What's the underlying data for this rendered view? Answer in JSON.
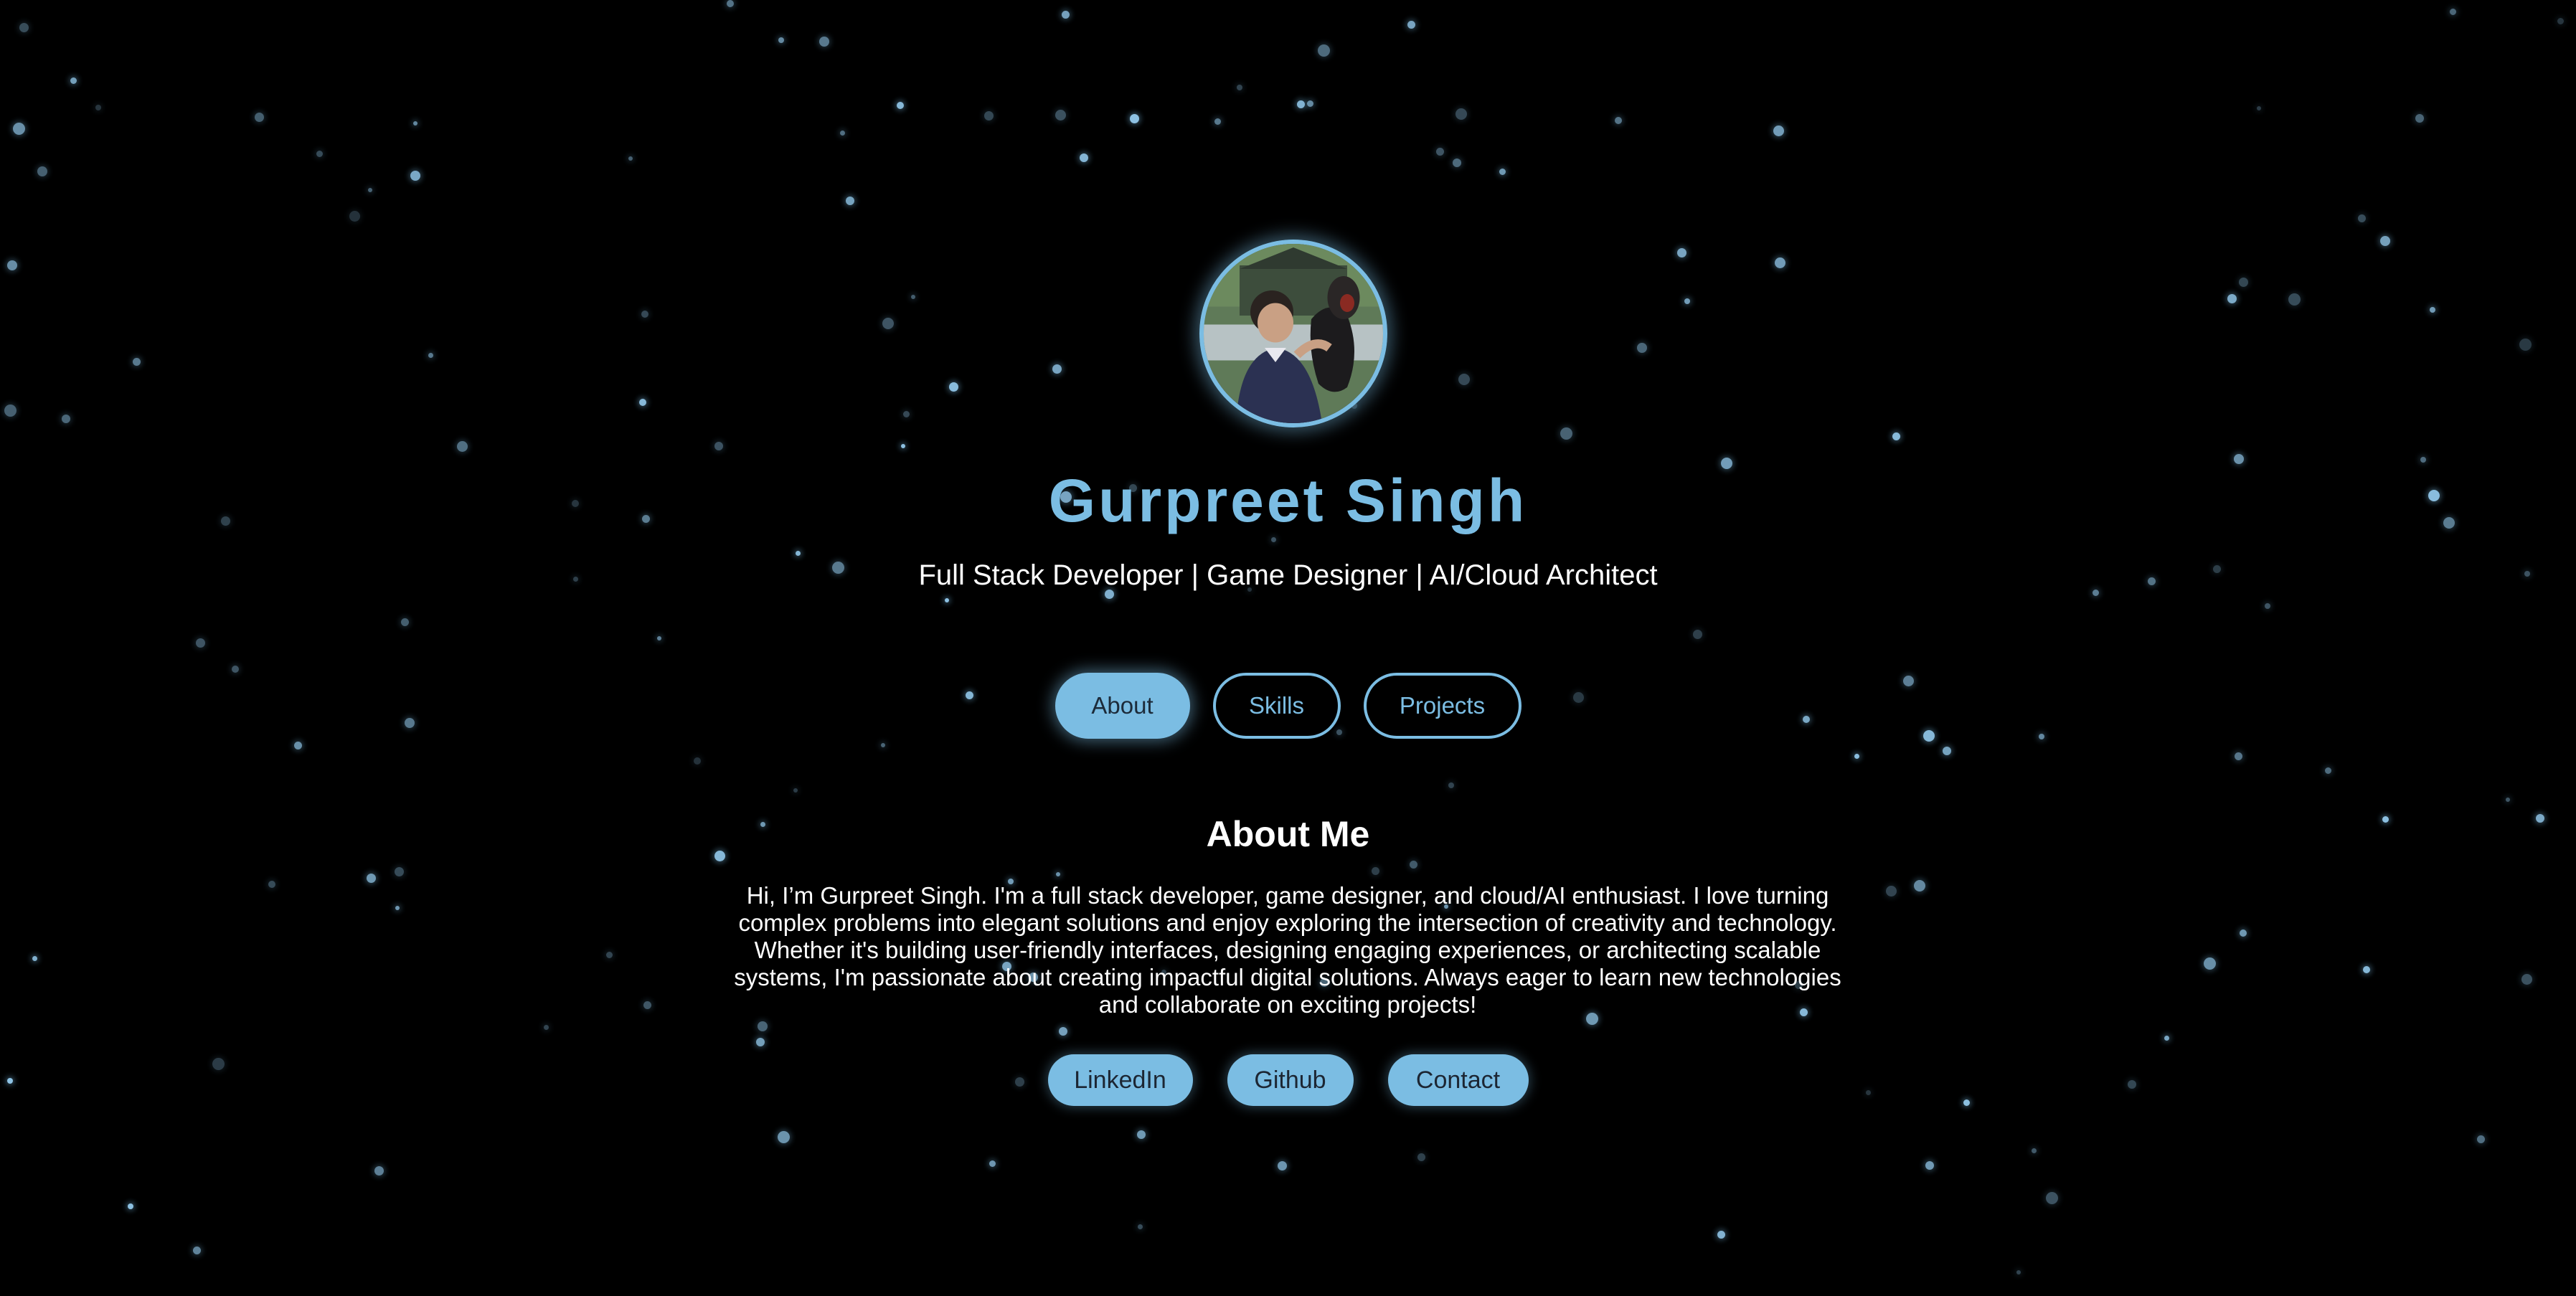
{
  "profile": {
    "name": "Gurpreet Singh",
    "tagline": "Full Stack Developer | Game Designer | AI/Cloud Architect",
    "avatar_alt": "profile-photo"
  },
  "nav": {
    "items": [
      {
        "label": "About",
        "active": true
      },
      {
        "label": "Skills",
        "active": false
      },
      {
        "label": "Projects",
        "active": false
      }
    ]
  },
  "about": {
    "title": "About Me",
    "text": "Hi, I’m Gurpreet Singh. I'm a full stack developer, game designer, and cloud/AI enthusiast. I love turning complex problems into elegant solutions and enjoy exploring the intersection of creativity and technology. Whether it's building user-friendly interfaces, designing engaging experiences, or architecting scalable systems, I'm passionate about creating impactful digital solutions. Always eager to learn new technologies and collaborate on exciting projects!"
  },
  "links": {
    "items": [
      {
        "label": "LinkedIn"
      },
      {
        "label": "Github"
      },
      {
        "label": "Contact"
      }
    ]
  },
  "theme": {
    "accent": "#7bbde3",
    "background": "#000000",
    "text": "#ffffff"
  }
}
